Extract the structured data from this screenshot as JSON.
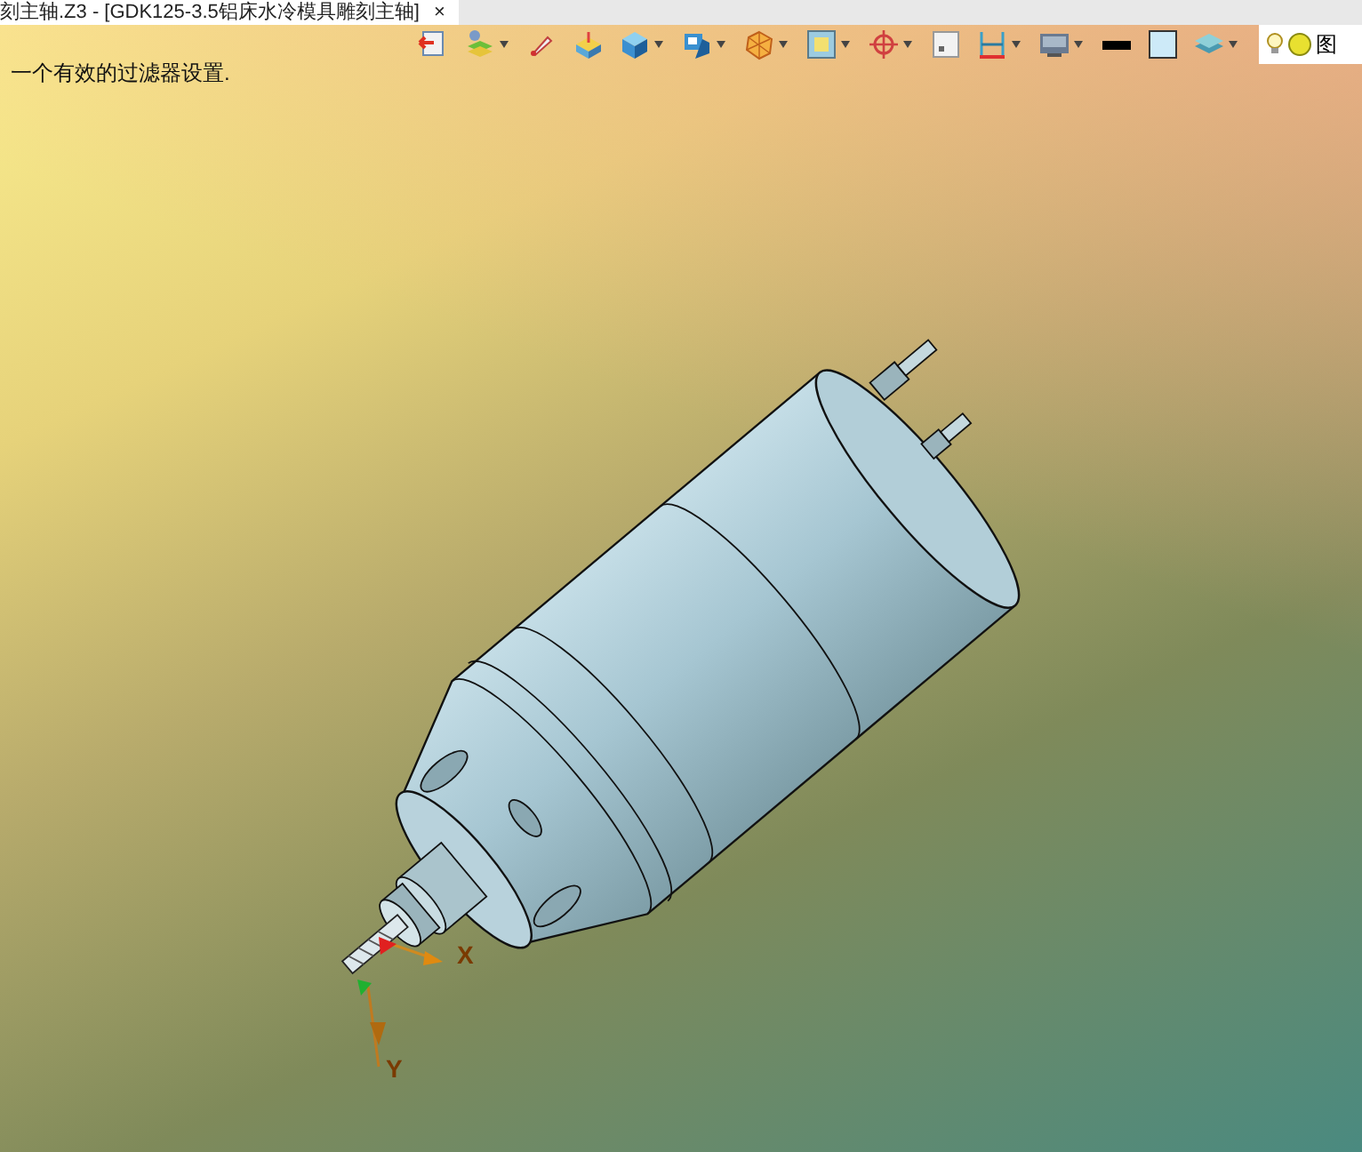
{
  "document_tab": {
    "title": "刻主轴.Z3 - [GDK125-3.5铝床水冷模具雕刻主轴]",
    "close": "×"
  },
  "status_message": "一个有效的过滤器设置.",
  "layer_field": {
    "value": "图"
  },
  "axis_triad": {
    "x_label": "X",
    "y_label": "Y"
  }
}
